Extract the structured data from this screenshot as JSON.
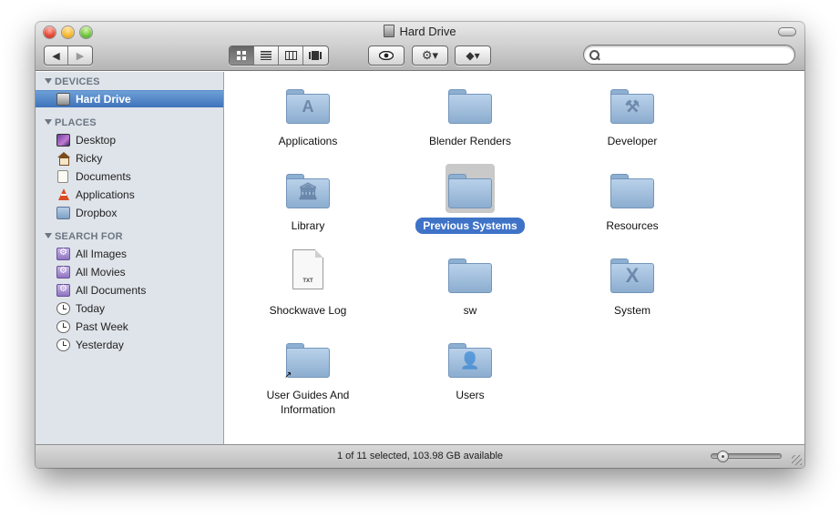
{
  "window": {
    "title": "Hard Drive"
  },
  "toolbar": {
    "back_icon": "◀",
    "forward_icon": "▶",
    "view_icons": [
      "icon-view-icon",
      "list-view-icon",
      "column-view-icon",
      "coverflow-view-icon"
    ],
    "active_view": "icon",
    "quicklook_icon": "👁",
    "action_icon": "⚙▾",
    "dropbox_icon": "◆▾"
  },
  "search": {
    "placeholder": "",
    "value": ""
  },
  "sidebar": {
    "devices_header": "DEVICES",
    "devices": [
      {
        "label": "Hard Drive",
        "icon": "hard-drive-icon",
        "selected": true
      }
    ],
    "places_header": "PLACES",
    "places": [
      {
        "label": "Desktop",
        "icon": "desktop-icon"
      },
      {
        "label": "Ricky",
        "icon": "home-icon"
      },
      {
        "label": "Documents",
        "icon": "documents-icon"
      },
      {
        "label": "Applications",
        "icon": "applications-icon"
      },
      {
        "label": "Dropbox",
        "icon": "dropbox-folder-icon"
      }
    ],
    "search_header": "SEARCH FOR",
    "searches": [
      {
        "label": "All Images",
        "icon": "smart-folder-icon"
      },
      {
        "label": "All Movies",
        "icon": "smart-folder-icon"
      },
      {
        "label": "All Documents",
        "icon": "smart-folder-icon"
      },
      {
        "label": "Today",
        "icon": "clock-icon"
      },
      {
        "label": "Past Week",
        "icon": "clock-icon"
      },
      {
        "label": "Yesterday",
        "icon": "clock-icon"
      }
    ]
  },
  "items": [
    {
      "label": "Applications",
      "icon": "applications-folder-icon",
      "glyph": "A"
    },
    {
      "label": "Blender Renders",
      "icon": "folder-icon",
      "glyph": ""
    },
    {
      "label": "Developer",
      "icon": "developer-folder-icon",
      "glyph": "⚒"
    },
    {
      "label": "Library",
      "icon": "library-folder-icon",
      "glyph": "🏛"
    },
    {
      "label": "Previous Systems",
      "icon": "folder-icon",
      "glyph": "",
      "selected": true
    },
    {
      "label": "Resources",
      "icon": "folder-icon",
      "glyph": ""
    },
    {
      "label": "Shockwave Log",
      "icon": "text-document-icon",
      "doc_tag": "TXT"
    },
    {
      "label": "sw",
      "icon": "folder-icon",
      "glyph": ""
    },
    {
      "label": "System",
      "icon": "system-folder-icon",
      "glyph": "X"
    },
    {
      "label": "User Guides And Information",
      "icon": "alias-folder-icon",
      "glyph": "",
      "alias_mark": "↗"
    },
    {
      "label": "Users",
      "icon": "users-folder-icon",
      "glyph": "👤"
    }
  ],
  "status": {
    "text": "1 of 11 selected, 103.98 GB available",
    "icon_size_level": 0.1
  }
}
